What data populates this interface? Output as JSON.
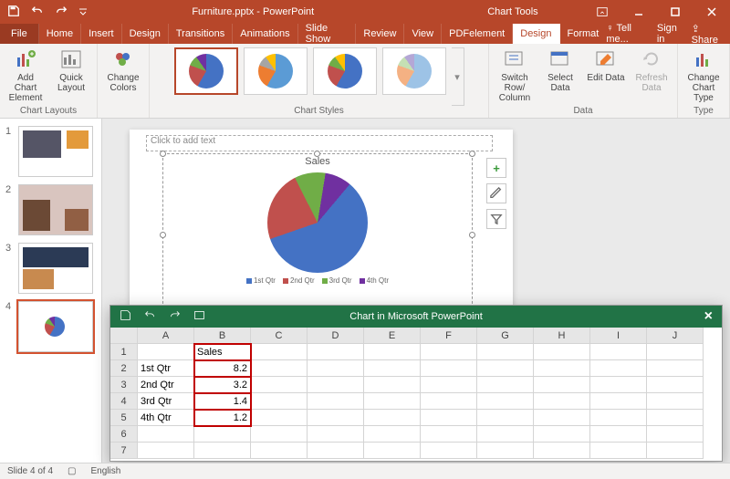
{
  "title": {
    "doc": "Furniture.pptx - PowerPoint",
    "context": "Chart Tools"
  },
  "menu": {
    "file": "File",
    "home": "Home",
    "insert": "Insert",
    "design": "Design",
    "transitions": "Transitions",
    "animations": "Animations",
    "slideshow": "Slide Show",
    "review": "Review",
    "view": "View",
    "pdfelement": "PDFelement",
    "design2": "Design",
    "format": "Format",
    "tellme": "Tell me...",
    "signin": "Sign in",
    "share": "Share"
  },
  "ribbon": {
    "groups": {
      "layouts": "Chart Layouts",
      "styles": "Chart Styles",
      "data": "Data",
      "type": "Type"
    },
    "addchart": "Add Chart Element",
    "quicklayout": "Quick Layout",
    "changecolors": "Change Colors",
    "switch": "Switch Row/ Column",
    "select": "Select Data",
    "edit": "Edit Data",
    "refresh": "Refresh Data",
    "changetype": "Change Chart Type"
  },
  "slide": {
    "placeholder": "Click to add text"
  },
  "excel_title": "Chart in Microsoft PowerPoint",
  "excel": {
    "cols": [
      "A",
      "B",
      "C",
      "D",
      "E",
      "F",
      "G",
      "H",
      "I",
      "J"
    ],
    "header": "Sales",
    "rows": [
      {
        "label": "1st Qtr",
        "value": "8.2"
      },
      {
        "label": "2nd Qtr",
        "value": "3.2"
      },
      {
        "label": "3rd Qtr",
        "value": "1.4"
      },
      {
        "label": "4th Qtr",
        "value": "1.2"
      }
    ]
  },
  "status": {
    "slide": "Slide 4 of 4",
    "lang": "English"
  },
  "chart_data": {
    "type": "pie",
    "title": "Sales",
    "categories": [
      "1st Qtr",
      "2nd Qtr",
      "3rd Qtr",
      "4th Qtr"
    ],
    "values": [
      8.2,
      3.2,
      1.4,
      1.2
    ],
    "colors": [
      "#4472c4",
      "#c0504d",
      "#70ad47",
      "#7030a0"
    ],
    "legend_position": "bottom"
  }
}
